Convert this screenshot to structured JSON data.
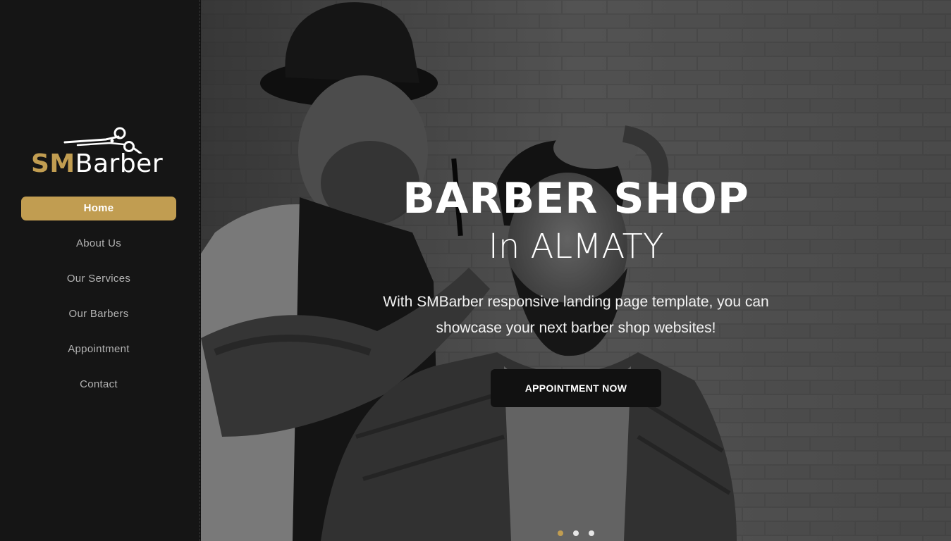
{
  "logo": {
    "text_accent": "SM",
    "text_main": "Barber",
    "icon": "scissors-icon",
    "accent_color": "#c19d51"
  },
  "nav": {
    "items": [
      {
        "label": "Home",
        "active": true
      },
      {
        "label": "About Us",
        "active": false
      },
      {
        "label": "Our Services",
        "active": false
      },
      {
        "label": "Our Barbers",
        "active": false
      },
      {
        "label": "Appointment",
        "active": false
      },
      {
        "label": "Contact",
        "active": false
      }
    ]
  },
  "hero": {
    "title": "BARBER SHOP",
    "subtitle": "In ALMATY",
    "description": "With SMBarber responsive landing page template, you can showcase your next barber shop websites!",
    "button_label": "APPOINTMENT NOW",
    "slides": {
      "count": 3,
      "active_index": 0
    }
  }
}
